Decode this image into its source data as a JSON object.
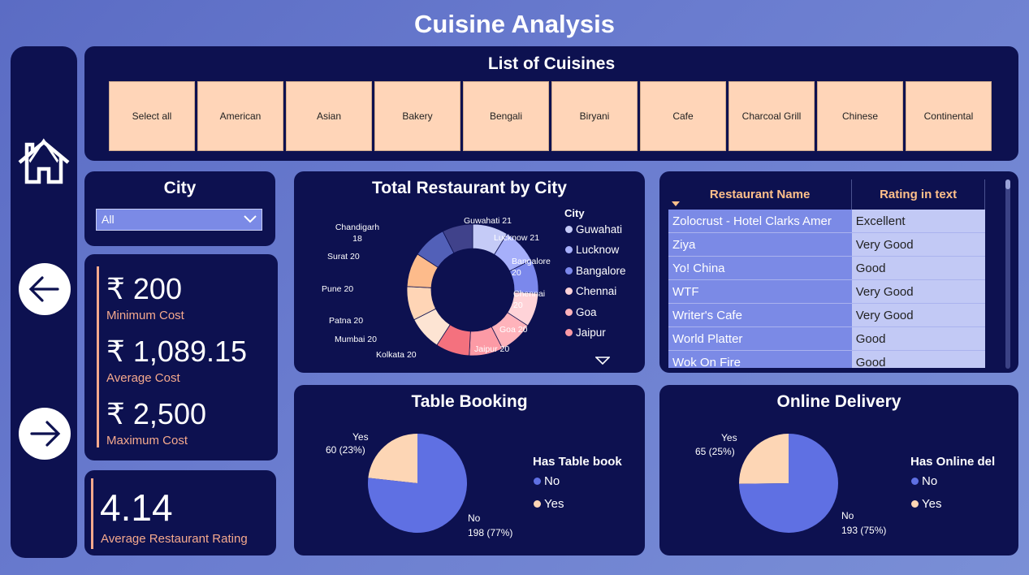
{
  "page": {
    "title": "Cuisine Analysis"
  },
  "nav": {
    "home_icon": "home-icon",
    "back_icon": "arrow-left-icon",
    "forward_icon": "arrow-right-icon"
  },
  "cuisines": {
    "title": "List of Cuisines",
    "items": [
      "Select all",
      "American",
      "Asian",
      "Bakery",
      "Bengali",
      "Biryani",
      "Cafe",
      "Charcoal Grill",
      "Chinese",
      "Continental"
    ]
  },
  "city_filter": {
    "title": "City",
    "selected": "All"
  },
  "costs": {
    "min_value": "₹ 200",
    "min_label": "Minimum Cost",
    "avg_value": "₹ 1,089.15",
    "avg_label": "Average Cost",
    "max_value": "₹ 2,500",
    "max_label": "Maximum Cost"
  },
  "rating": {
    "value": "4.14",
    "label": "Average Restaurant Rating"
  },
  "chart_data": [
    {
      "type": "pie",
      "title": "Total Restaurant by City",
      "legend_title": "City",
      "categories": [
        "Guwahati",
        "Lucknow",
        "Bangalore",
        "Chennai",
        "Goa",
        "Jaipur",
        "Kolkata",
        "Mumbai",
        "Patna",
        "Pune",
        "Surat",
        "Chandigarh"
      ],
      "values": [
        21,
        21,
        20,
        20,
        20,
        20,
        20,
        20,
        20,
        20,
        20,
        18
      ],
      "labels": [
        "Guwahati 21",
        "Lucknow 21",
        "Bangalore 20",
        "Chennai 20",
        "Goa 20",
        "Jaipur 20",
        "Kolkata 20",
        "Mumbai 20",
        "Patna 20",
        "Pune 20",
        "Surat 20",
        "Chandigarh 18"
      ],
      "legend_shown": [
        "Guwahati",
        "Lucknow",
        "Bangalore",
        "Chennai",
        "Goa",
        "Jaipur"
      ],
      "colors": [
        "#c5cbf7",
        "#a6affa",
        "#7b88ec",
        "#ffd3d8",
        "#ffb3bb",
        "#fc9aa5",
        "#f4717e",
        "#fde4d3",
        "#ffd5b6",
        "#fdbb8b",
        "#5260b8",
        "#40428b",
        "#6a6fa5"
      ]
    },
    {
      "type": "pie",
      "title": "Table Booking",
      "legend_title": "Has Table book",
      "categories": [
        "No",
        "Yes"
      ],
      "values": [
        198,
        60
      ],
      "labels": [
        "198 (77%)",
        "60 (23%)"
      ],
      "colors": [
        "#5f70e3",
        "#fdd6b5"
      ]
    },
    {
      "type": "pie",
      "title": "Online Delivery",
      "legend_title": "Has Online del",
      "categories": [
        "No",
        "Yes"
      ],
      "values": [
        193,
        65
      ],
      "labels": [
        "193 (75%)",
        "65 (25%)"
      ],
      "colors": [
        "#5f70e3",
        "#fdd6b5"
      ]
    }
  ],
  "restaurants": {
    "headers": [
      "Restaurant Name",
      "Rating in text"
    ],
    "rows": [
      [
        "Zolocrust - Hotel Clarks Amer",
        "Excellent"
      ],
      [
        "Ziya",
        "Very Good"
      ],
      [
        "Yo! China",
        "Good"
      ],
      [
        "WTF",
        "Very Good"
      ],
      [
        "Writer's Cafe",
        "Very Good"
      ],
      [
        "World Platter",
        "Good"
      ],
      [
        "Wok On Fire",
        "Good"
      ]
    ]
  }
}
